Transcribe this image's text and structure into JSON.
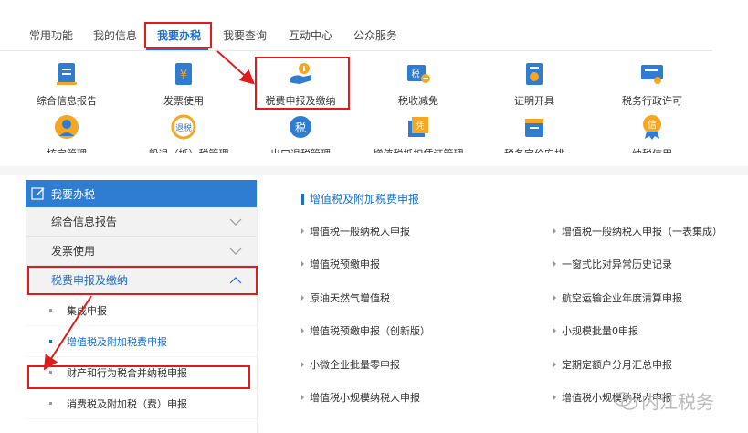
{
  "top_tabs": [
    "常用功能",
    "我的信息",
    "我要办税",
    "我要查询",
    "互动中心",
    "公众服务"
  ],
  "active_tab_index": 2,
  "icon_row1": [
    {
      "label": "综合信息报告",
      "icon": "document-icon"
    },
    {
      "label": "发票使用",
      "icon": "invoice-icon"
    },
    {
      "label": "税费申报及缴纳",
      "icon": "tax-payment-icon"
    },
    {
      "label": "税收减免",
      "icon": "tax-relief-icon"
    },
    {
      "label": "证明开具",
      "icon": "certificate-icon"
    },
    {
      "label": "税务行政许可",
      "icon": "license-icon"
    }
  ],
  "icon_row2": [
    {
      "label": "核定管理",
      "icon": "person-icon"
    },
    {
      "label": "一般退（抵）税管理",
      "icon": "refund-icon"
    },
    {
      "label": "出口退税管理",
      "icon": "export-tax-icon"
    },
    {
      "label": "增值税抵扣凭证管理",
      "icon": "voucher-icon"
    },
    {
      "label": "税务定价安排",
      "icon": "calendar-icon"
    },
    {
      "label": "纳税信用",
      "icon": "credit-medal-icon"
    }
  ],
  "sidebar": {
    "header": "我要办税",
    "groups": [
      {
        "label": "综合信息报告",
        "expanded": false
      },
      {
        "label": "发票使用",
        "expanded": false
      },
      {
        "label": "税费申报及缴纳",
        "expanded": true
      }
    ],
    "sub_items": [
      "集成申报",
      "增值税及附加税费申报",
      "财产和行为税合并纳税申报",
      "消费税及附加税（费）申报"
    ],
    "active_sub_index": 1
  },
  "panel": {
    "title": "增值税及附加税费申报",
    "left_links": [
      "增值税一般纳税人申报",
      "增值税预缴申报",
      "原油天然气增值税",
      "增值税预缴申报（创新版）",
      "小微企业批量零申报",
      "增值税小规模纳税人申报"
    ],
    "right_links": [
      "增值税一般纳税人申报（一表集成）",
      "一窗式比对异常历史记录",
      "航空运输企业年度清算申报",
      "小规模批量0申报",
      "定期定额户分月汇总申报",
      "增值税小规模纳税人申报"
    ]
  },
  "watermark": "内江税务",
  "colors": {
    "brand_blue": "#2f7cd3",
    "link_blue": "#1a6fd1",
    "annotation_red": "#e01b1b"
  }
}
